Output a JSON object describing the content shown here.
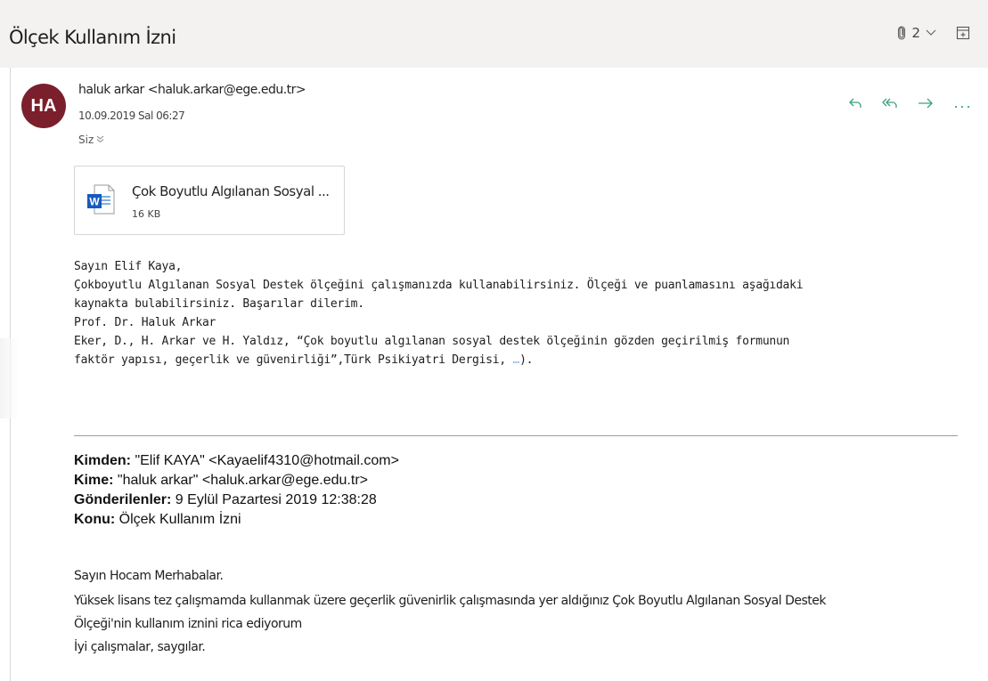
{
  "header": {
    "subject": "Ölçek Kullanım İzni",
    "attachment_count": "2"
  },
  "message": {
    "avatar_initials": "HA",
    "avatar_color": "#7a1f2b",
    "sender": "haluk arkar <haluk.arkar@ege.edu.tr>",
    "date": "10.09.2019 Sal 06:27",
    "to": "Siz",
    "action_color": "#3aa17e"
  },
  "attachment": {
    "name": "Çok Boyutlu Algılanan Sosyal ...",
    "size": "16 KB",
    "icon": "word-doc-icon"
  },
  "reply": {
    "lines": [
      "Sayın Elif Kaya,",
      "Çokboyutlu Algılanan Sosyal Destek ölçeğini çalışmanızda kullanabilirsiniz. Ölçeği ve puanlamasını aşağıdaki",
      "kaynakta bulabilirsiniz. Başarılar dilerim.",
      "Prof. Dr. Haluk Arkar",
      "Eker, D., H. Arkar ve H. Yaldız, “Çok boyutlu algılanan sosyal destek ölçeğinin gözden geçirilmiş formunun"
    ],
    "last_line_start": "faktör yapısı, geçerlik ve güvenirliği”,Türk Psikiyatri Dergisi, ",
    "last_line_link": "…",
    "last_line_end": ")."
  },
  "original": {
    "from_label": "Kimden:",
    "from_value": " \"Elif KAYA\" <Kayaelif4310@hotmail.com>",
    "to_label": "Kime:",
    "to_value": " \"haluk arkar\" <haluk.arkar@ege.edu.tr>",
    "sent_label": "Gönderilenler:",
    "sent_value": " 9 Eylül Pazartesi 2019 12:38:28",
    "subject_label": "Konu:",
    "subject_value": " Ölçek Kullanım İzni",
    "body": [
      "Sayın Hocam Merhabalar.",
      "Yüksek lisans tez çalışmamda kullanmak üzere geçerlik güvenirlik çalışmasında yer aldığınız Çok Boyutlu Algılanan Sosyal Destek",
      "Ölçeği'nin kullanım iznini rica ediyorum",
      "İyi çalışmalar, saygılar."
    ]
  }
}
